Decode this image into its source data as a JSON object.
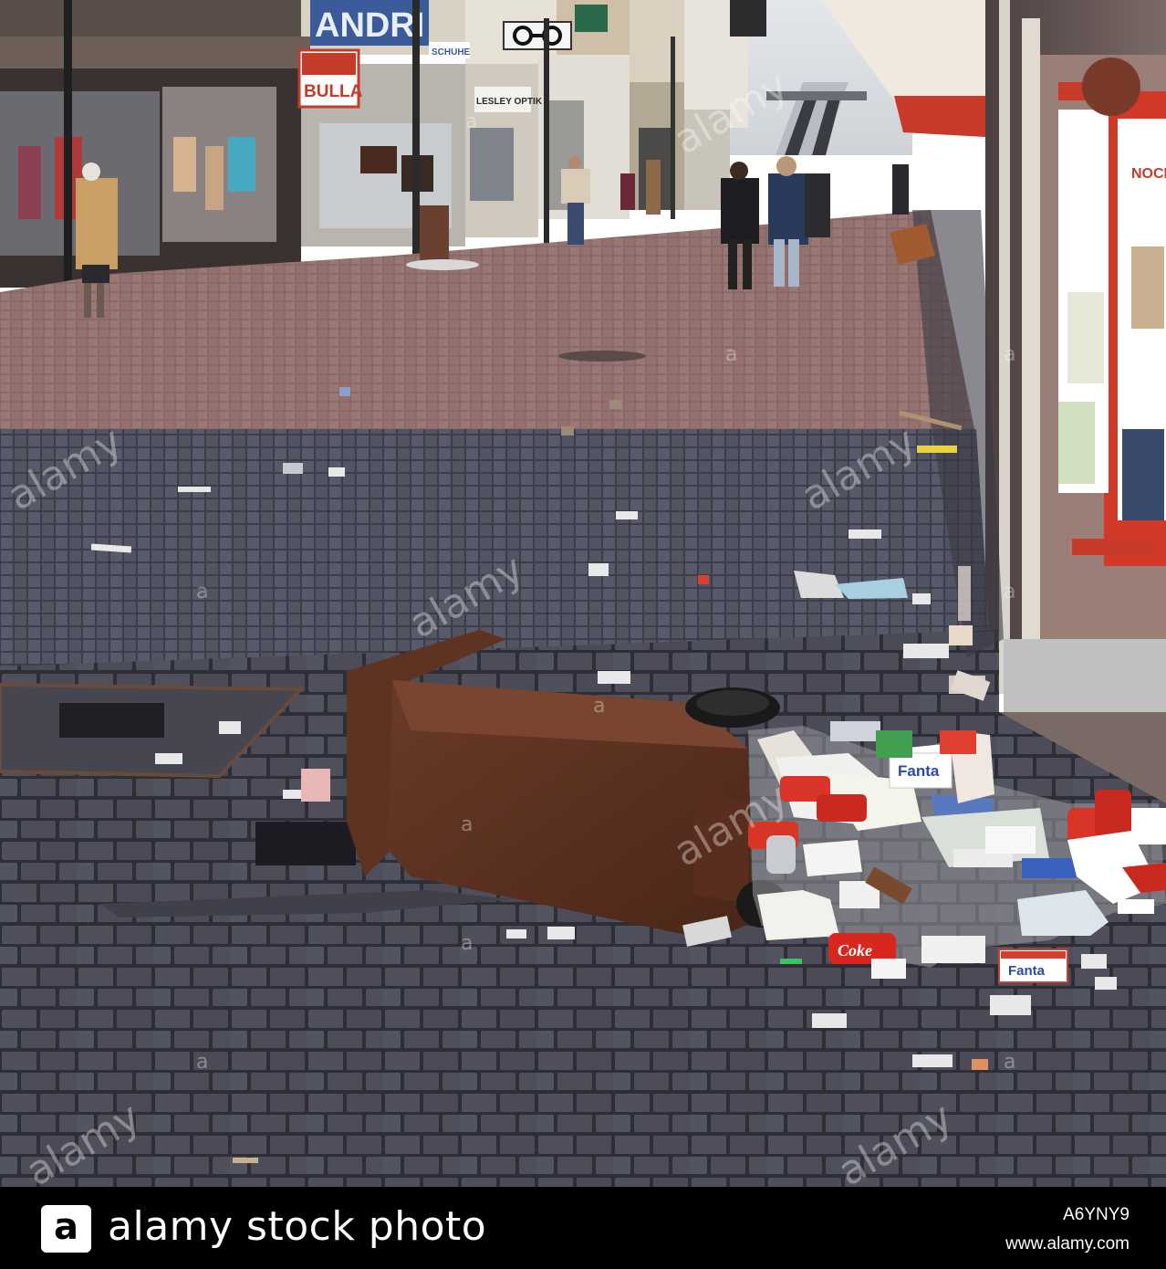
{
  "photo": {
    "alt": "Pedestrian shopping street with litter and an overturned brown wheelie bin",
    "signs": {
      "andri": "ANDRI",
      "bulla": "BULLA",
      "schuhe": "SCHUHE",
      "lesley": "LESLEY OPTIK",
      "noch": "NOCH"
    },
    "litter_labels": {
      "coke": "Coke",
      "fanta_1": "Fanta",
      "fanta_2": "Fanta"
    },
    "watermark_text": "alamy",
    "watermark_small": "a"
  },
  "footer": {
    "logo_letter": "a",
    "brand": "alamy stock photo",
    "image_id": "A6YNY9",
    "url": "www.alamy.com"
  }
}
